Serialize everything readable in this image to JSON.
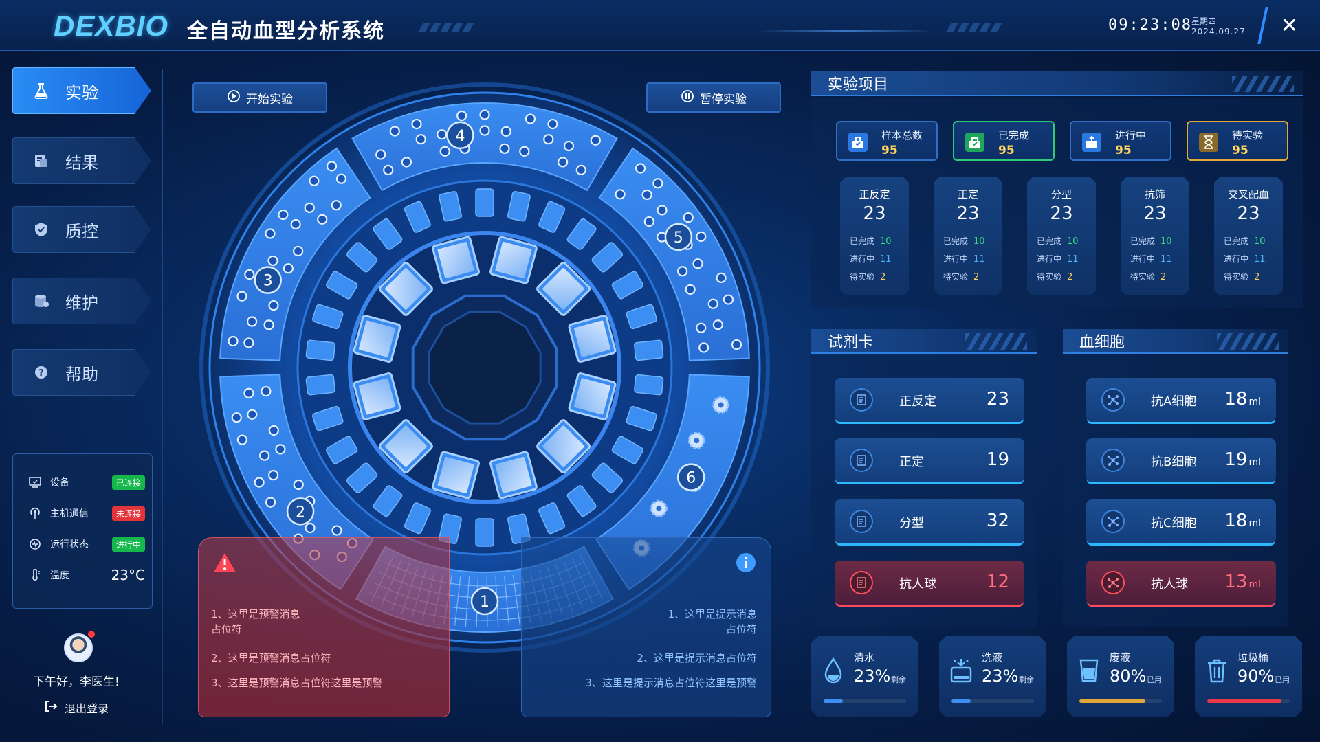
{
  "header": {
    "logo": "DEXBIO",
    "title": "全自动血型分析系统",
    "time": "09:23:08",
    "weekday": "星期四",
    "date": "2024.09.27"
  },
  "sidebar": {
    "items": [
      {
        "label": "实验",
        "icon": "flask-icon",
        "active": true
      },
      {
        "label": "结果",
        "icon": "result-icon",
        "active": false
      },
      {
        "label": "质控",
        "icon": "shield-icon",
        "active": false
      },
      {
        "label": "维护",
        "icon": "database-icon",
        "active": false
      },
      {
        "label": "帮助",
        "icon": "help-icon",
        "active": false
      }
    ],
    "status": {
      "device_label": "设备",
      "device_badge": "已连接",
      "comm_label": "主机通信",
      "comm_badge": "未连接",
      "run_label": "运行状态",
      "run_badge": "进行中",
      "temp_label": "温度",
      "temp_value": "23°C"
    },
    "greeting": "下午好，李医生!",
    "logout": "退出登录"
  },
  "controls": {
    "start_label": "开始实验",
    "pause_label": "暂停实验"
  },
  "carousel": {
    "zones": [
      "1",
      "2",
      "3",
      "4",
      "5",
      "6"
    ]
  },
  "warnings": {
    "lines": [
      "1、这里是预警消息占位符",
      "2、这里是预警消息占位符",
      "3、这里是预警消息占位符这里是预警"
    ]
  },
  "infos": {
    "lines": [
      "1、这里是提示消息占位符",
      "2、这里是提示消息占位符",
      "3、这里是提示消息占位符这里是预警"
    ]
  },
  "experiment": {
    "title": "实验项目",
    "summary": [
      {
        "label": "样本总数",
        "value": "95"
      },
      {
        "label": "已完成",
        "value": "95"
      },
      {
        "label": "进行中",
        "value": "95"
      },
      {
        "label": "待实验",
        "value": "95"
      }
    ],
    "row_labels": {
      "done": "已完成",
      "progress": "进行中",
      "pending": "待实验"
    },
    "types": [
      {
        "name": "正反定",
        "total": "23",
        "done": "10",
        "progress": "11",
        "pending": "2"
      },
      {
        "name": "正定",
        "total": "23",
        "done": "10",
        "progress": "11",
        "pending": "2"
      },
      {
        "name": "分型",
        "total": "23",
        "done": "10",
        "progress": "11",
        "pending": "2"
      },
      {
        "name": "抗筛",
        "total": "23",
        "done": "10",
        "progress": "11",
        "pending": "2"
      },
      {
        "name": "交叉配血",
        "total": "23",
        "done": "10",
        "progress": "11",
        "pending": "2"
      }
    ]
  },
  "reagent": {
    "title": "试剂卡",
    "items": [
      {
        "name": "正反定",
        "value": "23"
      },
      {
        "name": "正定",
        "value": "19"
      },
      {
        "name": "分型",
        "value": "32"
      },
      {
        "name": "抗人球",
        "value": "12"
      }
    ]
  },
  "cells": {
    "title": "血细胞",
    "unit": "ml",
    "items": [
      {
        "name": "抗A细胞",
        "value": "18"
      },
      {
        "name": "抗B细胞",
        "value": "19"
      },
      {
        "name": "抗C细胞",
        "value": "18"
      },
      {
        "name": "抗人球",
        "value": "13"
      }
    ]
  },
  "liquids": [
    {
      "name": "清水",
      "pct": "23%",
      "note": "剩余",
      "level": 0.23,
      "color": "#3d8ff0"
    },
    {
      "name": "洗液",
      "pct": "23%",
      "note": "剩余",
      "level": 0.23,
      "color": "#3d8ff0"
    },
    {
      "name": "废液",
      "pct": "80%",
      "note": "已用",
      "level": 0.8,
      "color": "#e0a838"
    },
    {
      "name": "垃圾桶",
      "pct": "90%",
      "note": "已用",
      "level": 0.9,
      "color": "#e8394a"
    }
  ]
}
